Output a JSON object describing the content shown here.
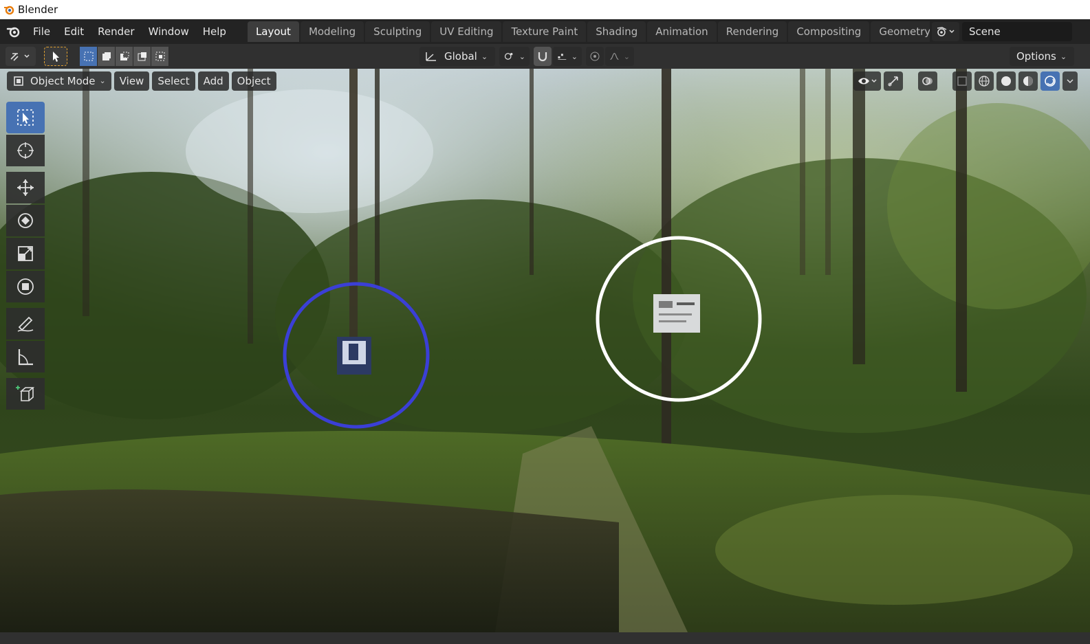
{
  "window": {
    "title": "Blender"
  },
  "menu": [
    "File",
    "Edit",
    "Render",
    "Window",
    "Help"
  ],
  "workspaces": [
    {
      "label": "Layout",
      "active": true
    },
    {
      "label": "Modeling",
      "active": false
    },
    {
      "label": "Sculpting",
      "active": false
    },
    {
      "label": "UV Editing",
      "active": false
    },
    {
      "label": "Texture Paint",
      "active": false
    },
    {
      "label": "Shading",
      "active": false
    },
    {
      "label": "Animation",
      "active": false
    },
    {
      "label": "Rendering",
      "active": false
    },
    {
      "label": "Compositing",
      "active": false
    },
    {
      "label": "Geometry Nc",
      "active": false
    }
  ],
  "scene": {
    "name": "Scene"
  },
  "tool_header": {
    "orientation": "Global",
    "options_label": "Options"
  },
  "viewport_header": {
    "mode": "Object Mode",
    "menus": [
      "View",
      "Select",
      "Add",
      "Object"
    ]
  },
  "toolbar": {
    "tools": [
      "select-box-tool",
      "cursor-tool",
      "move-tool",
      "rotate-tool",
      "scale-tool",
      "transform-tool",
      "annotate-tool",
      "measure-tool",
      "add-cube-tool"
    ],
    "active": "select-box-tool"
  },
  "annotations": {
    "blue_circle_color": "#3b3fd6",
    "white_circle_color": "#ffffff"
  },
  "colors": {
    "accent": "#4772b3",
    "topbar": "#232323",
    "header": "#303030"
  }
}
